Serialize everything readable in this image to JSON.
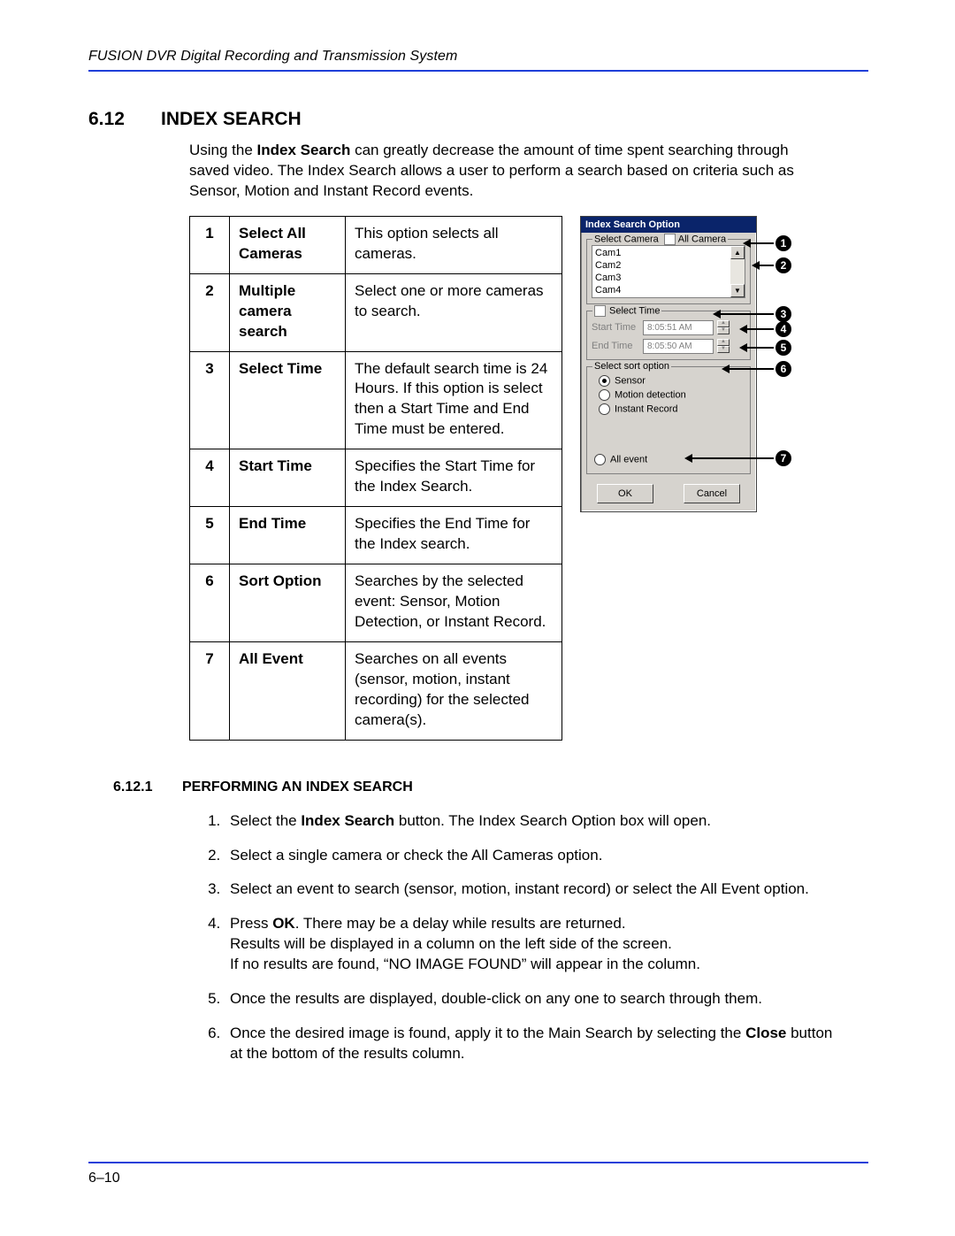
{
  "header": "FUSION DVR Digital Recording and Transmission System",
  "section": {
    "num": "6.12",
    "title": "INDEX SEARCH"
  },
  "intro_pre": "Using the ",
  "intro_bold": "Index Search",
  "intro_post": " can greatly decrease the amount of time spent searching through saved video. The Index Search allows a user to perform a search based on criteria such as Sensor, Motion and Instant Record events.",
  "legend": [
    {
      "n": "1",
      "name": "Select All Cameras",
      "desc": "This option selects all cameras."
    },
    {
      "n": "2",
      "name": "Multiple camera search",
      "desc": "Select one or more cameras to search."
    },
    {
      "n": "3",
      "name": "Select Time",
      "desc": "The default search time is 24 Hours. If this option is select then a Start Time and End Time must be entered."
    },
    {
      "n": "4",
      "name": "Start Time",
      "desc": "Specifies the Start Time for the Index Search."
    },
    {
      "n": "5",
      "name": "End Time",
      "desc": "Specifies the End Time for the Index search."
    },
    {
      "n": "6",
      "name": "Sort Option",
      "desc": "Searches by the selected event: Sensor, Motion Detection, or Instant Record."
    },
    {
      "n": "7",
      "name": "All Event",
      "desc": "Searches on all events (sensor, motion, instant recording) for the selected camera(s)."
    }
  ],
  "dlg": {
    "title": "Index Search Option",
    "select_camera_label": "Select Camera",
    "all_camera_label": "All Camera",
    "cams": [
      "Cam1",
      "Cam2",
      "Cam3",
      "Cam4"
    ],
    "select_time_label": "Select Time",
    "start_label": "Start Time",
    "start_val": "8:05:51 AM",
    "end_label": "End Time",
    "end_val": "8:05:50 AM",
    "sort_label": "Select sort option",
    "sort_options": [
      "Sensor",
      "Motion detection",
      "Instant Record"
    ],
    "all_event_label": "All event",
    "ok": "OK",
    "cancel": "Cancel"
  },
  "callout_nums": [
    "1",
    "2",
    "3",
    "4",
    "5",
    "6",
    "7"
  ],
  "sub": {
    "num": "6.12.1",
    "title": "PERFORMING AN INDEX SEARCH"
  },
  "steps": {
    "s1a": "Select the ",
    "s1b": "Index Search",
    "s1c": " button. The Index Search Option box will open.",
    "s2": "Select a single camera or check the All Cameras option.",
    "s3": "Select an event to search (sensor, motion, instant record) or select the All Event option.",
    "s4a": "Press ",
    "s4b": "OK",
    "s4c": ". There may be a delay while results are returned.\nResults will be displayed in a column on the left side of the screen.\nIf no results are found, “NO IMAGE FOUND” will appear in the column.",
    "s5": "Once the results are displayed, double-click on any one to search through them.",
    "s6a": "Once the desired image is found, apply it to the Main Search by selecting the ",
    "s6b": "Close",
    "s6c": " button at the bottom of the results column."
  },
  "page_num": "6–10"
}
